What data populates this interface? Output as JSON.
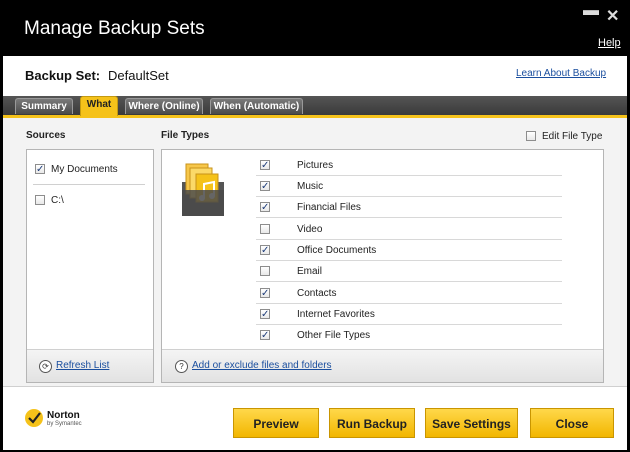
{
  "window": {
    "title": "Manage Backup Sets",
    "help": "Help",
    "minimize": "▬",
    "close": "✕"
  },
  "setbar": {
    "label": "Backup Set:",
    "name": "DefaultSet",
    "learn_link": "Learn About Backup"
  },
  "tabs": [
    {
      "label": "Summary",
      "active": false
    },
    {
      "label": "What",
      "active": true
    },
    {
      "label": "Where (Online)",
      "active": false
    },
    {
      "label": "When (Automatic)",
      "active": false
    }
  ],
  "sources": {
    "header": "Sources",
    "items": [
      {
        "label": "My Documents",
        "checked": true
      },
      {
        "label": "C:\\",
        "checked": false
      }
    ],
    "refresh_link": "Refresh List"
  },
  "file_types": {
    "header": "File Types",
    "edit_label": "Edit File Type",
    "edit_checked": false,
    "items": [
      {
        "label": "Pictures",
        "checked": true
      },
      {
        "label": "Music",
        "checked": true
      },
      {
        "label": "Financial Files",
        "checked": true
      },
      {
        "label": "Video",
        "checked": false
      },
      {
        "label": "Office Documents",
        "checked": true
      },
      {
        "label": "Email",
        "checked": false
      },
      {
        "label": "Contacts",
        "checked": true
      },
      {
        "label": "Internet Favorites",
        "checked": true
      },
      {
        "label": "Other File Types",
        "checked": true
      }
    ],
    "add_link": "Add or exclude files and folders"
  },
  "buttons": {
    "preview": "Preview",
    "run": "Run Backup",
    "save": "Save Settings",
    "close": "Close"
  },
  "brand": {
    "name": "Norton",
    "sub": "by Symantec"
  },
  "colors": {
    "accent": "#f5c21a",
    "link": "#1a4e9e"
  }
}
